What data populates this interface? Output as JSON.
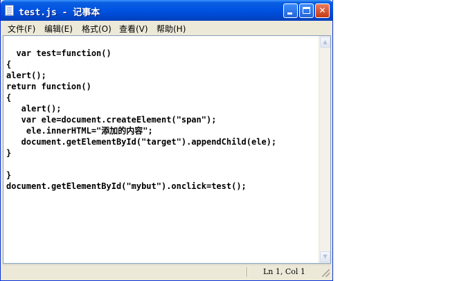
{
  "window": {
    "title": "test.js - 记事本",
    "minimize_glyph": "",
    "maximize_glyph": "",
    "close_glyph": "✕"
  },
  "menu": {
    "items": [
      {
        "label": "文件(F)"
      },
      {
        "label": "编辑(E)"
      },
      {
        "label": "格式(O)"
      },
      {
        "label": "查看(V)"
      },
      {
        "label": "帮助(H)"
      }
    ]
  },
  "editor": {
    "lines": [
      "  var test=function()",
      "{",
      "alert();",
      "return function()",
      "{",
      "   alert();",
      "   var ele=document.createElement(\"span\");",
      "    ele.innerHTML=\"添加的内容\";",
      "   document.getElementById(\"target\").appendChild(ele);",
      "}",
      "",
      "}",
      "document.getElementById(\"mybut\").onclick=test();"
    ]
  },
  "scrollbar": {
    "up_glyph": "▲",
    "down_glyph": "▼"
  },
  "status": {
    "position": "Ln 1, Col 1"
  }
}
